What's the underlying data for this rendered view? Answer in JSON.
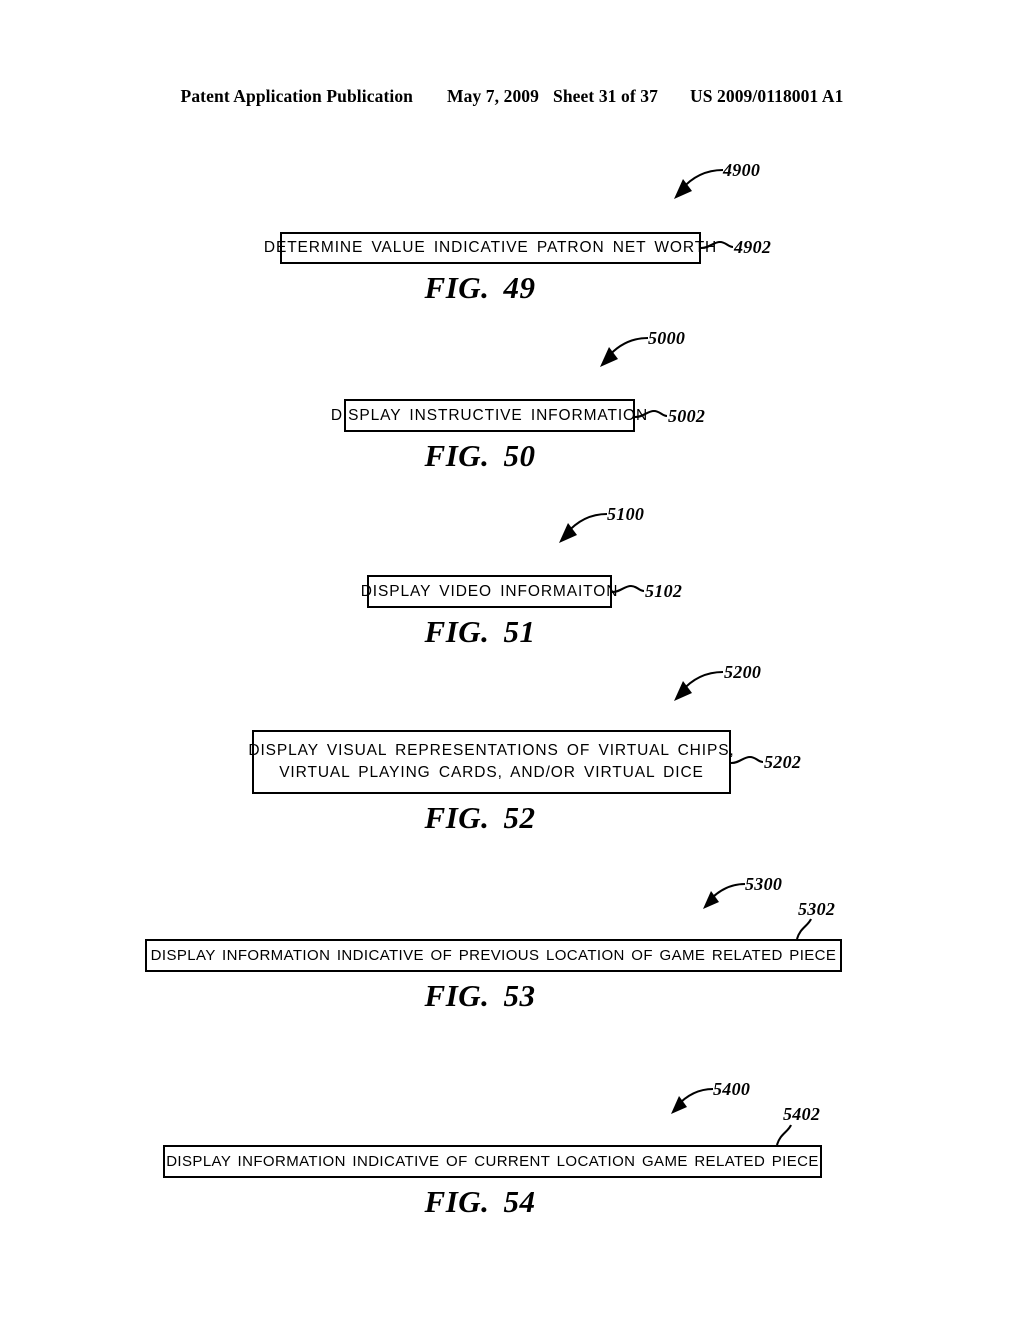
{
  "header": {
    "publication": "Patent Application Publication",
    "date": "May 7, 2009",
    "sheet": "Sheet 31 of 37",
    "patent_number": "US 2009/0118001 A1"
  },
  "figures": [
    {
      "id": "fig49",
      "caption_prefix": "FIG.",
      "caption_number": "49",
      "flow_ref": "4900",
      "step_ref": "4902",
      "box_lines": [
        "DETERMINE VALUE INDICATIVE PATRON NET WORTH"
      ]
    },
    {
      "id": "fig50",
      "caption_prefix": "FIG.",
      "caption_number": "50",
      "flow_ref": "5000",
      "step_ref": "5002",
      "box_lines": [
        "DISPLAY INSTRUCTIVE INFORMATION"
      ]
    },
    {
      "id": "fig51",
      "caption_prefix": "FIG.",
      "caption_number": "51",
      "flow_ref": "5100",
      "step_ref": "5102",
      "box_lines": [
        "DISPLAY VIDEO INFORMAITON"
      ]
    },
    {
      "id": "fig52",
      "caption_prefix": "FIG.",
      "caption_number": "52",
      "flow_ref": "5200",
      "step_ref": "5202",
      "box_lines": [
        "DISPLAY VISUAL REPRESENTATIONS OF VIRTUAL CHIPS,",
        "VIRTUAL PLAYING CARDS, AND/OR VIRTUAL DICE"
      ]
    },
    {
      "id": "fig53",
      "caption_prefix": "FIG.",
      "caption_number": "53",
      "flow_ref": "5300",
      "step_ref": "5302",
      "box_lines": [
        "DISPLAY INFORMATION INDICATIVE OF PREVIOUS LOCATION OF GAME RELATED PIECE"
      ]
    },
    {
      "id": "fig54",
      "caption_prefix": "FIG.",
      "caption_number": "54",
      "flow_ref": "5400",
      "step_ref": "5402",
      "box_lines": [
        "DISPLAY INFORMATION INDICATIVE OF CURRENT LOCATION GAME RELATED PIECE"
      ]
    }
  ],
  "colors": {
    "ink": "#000000",
    "paper": "#ffffff"
  }
}
